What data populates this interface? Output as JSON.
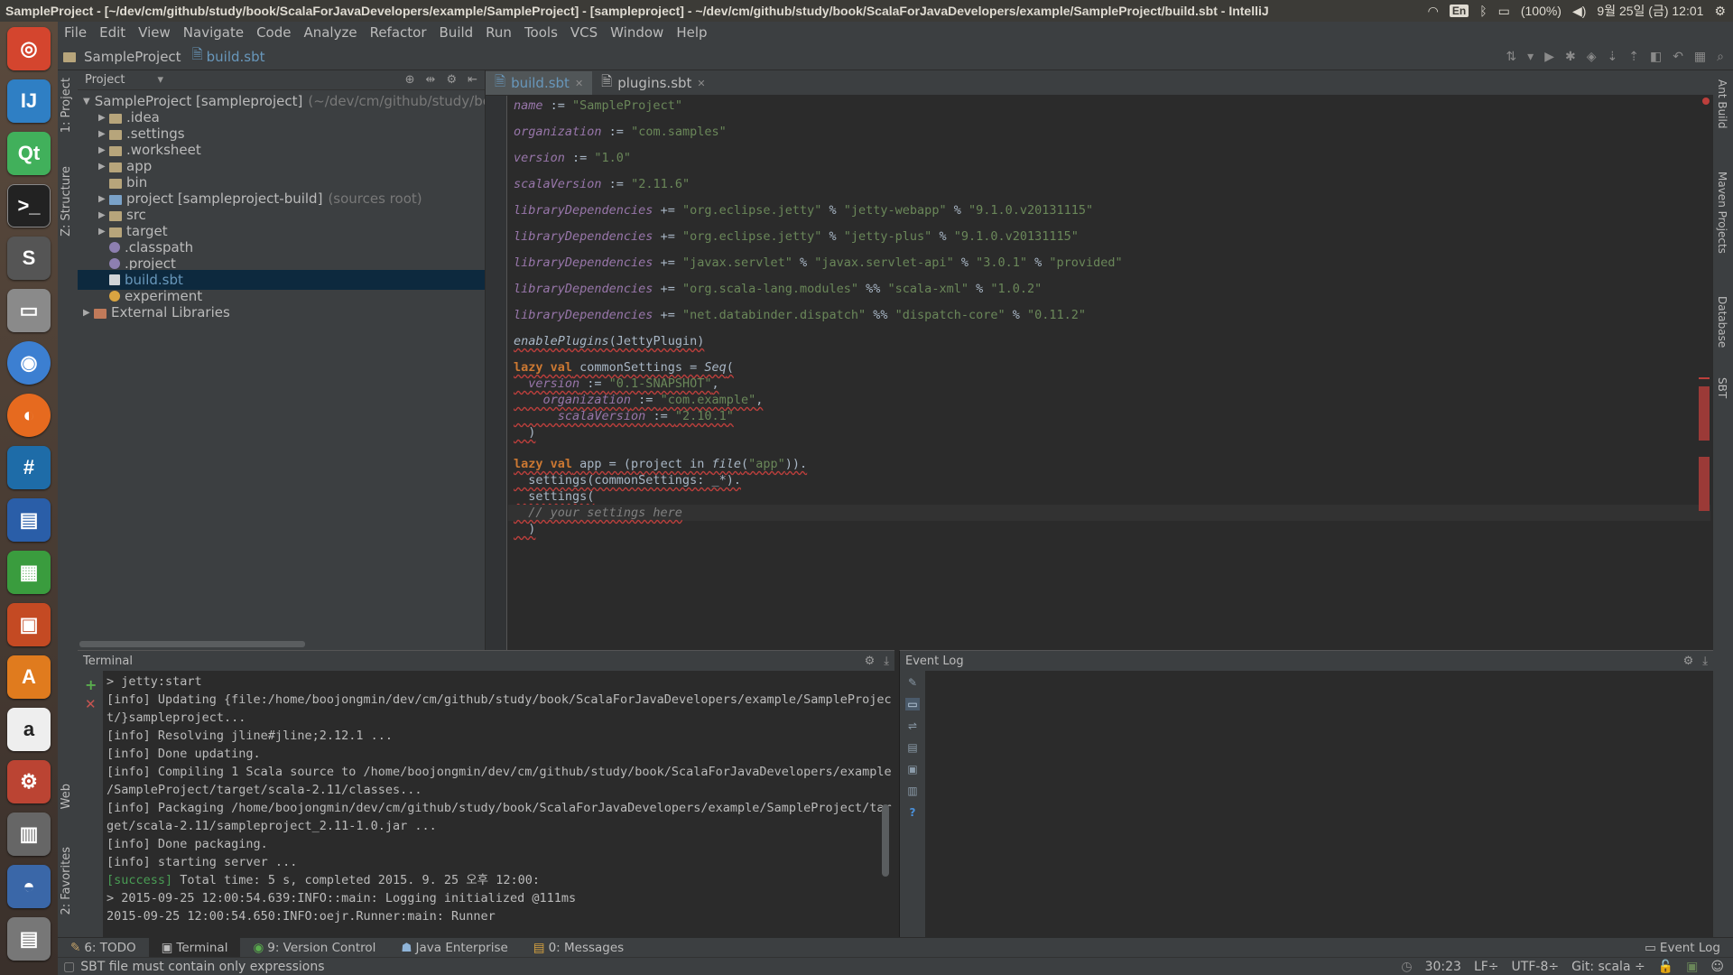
{
  "system": {
    "title": "SampleProject - [~/dev/cm/github/study/book/ScalaForJavaDevelopers/example/SampleProject] - [sampleproject] - ~/dev/cm/github/study/book/ScalaForJavaDevelopers/example/SampleProject/build.sbt - IntelliJ",
    "keyboard": "En",
    "battery": "(100%)",
    "datetime": "9월 25일 (금) 12:01"
  },
  "menu": [
    "File",
    "Edit",
    "View",
    "Navigate",
    "Code",
    "Analyze",
    "Refactor",
    "Build",
    "Run",
    "Tools",
    "VCS",
    "Window",
    "Help"
  ],
  "breadcrumbs": {
    "project": "SampleProject",
    "file": "build.sbt"
  },
  "left_tabs": {
    "project": "1: Project",
    "structure": "Z: Structure",
    "web": "Web",
    "favorites": "2: Favorites"
  },
  "right_tabs": {
    "ant": "Ant Build",
    "maven": "Maven Projects",
    "database": "Database",
    "sbt": "SBT"
  },
  "project_panel": {
    "view": "Project",
    "tree": [
      {
        "label": "SampleProject [sampleproject]",
        "note": "(~/dev/cm/github/study/boo",
        "arrow": "▼",
        "kind": "folder"
      },
      {
        "label": ".idea",
        "arrow": "▶",
        "kind": "folder"
      },
      {
        "label": ".settings",
        "arrow": "▶",
        "kind": "folder"
      },
      {
        "label": ".worksheet",
        "arrow": "▶",
        "kind": "folder"
      },
      {
        "label": "app",
        "arrow": "▶",
        "kind": "folder"
      },
      {
        "label": "bin",
        "arrow": "",
        "kind": "folder"
      },
      {
        "label": "project [sampleproject-build]",
        "note": "(sources root)",
        "arrow": "▶",
        "kind": "module"
      },
      {
        "label": "src",
        "arrow": "▶",
        "kind": "folder"
      },
      {
        "label": "target",
        "arrow": "▶",
        "kind": "folder"
      },
      {
        "label": ".classpath",
        "arrow": "",
        "kind": "file"
      },
      {
        "label": ".project",
        "arrow": "",
        "kind": "file"
      },
      {
        "label": "build.sbt",
        "arrow": "",
        "kind": "sbt",
        "selected": true
      },
      {
        "label": "experiment",
        "arrow": "",
        "kind": "run"
      },
      {
        "label": "External Libraries",
        "arrow": "▶",
        "kind": "lib"
      }
    ]
  },
  "editor_tabs": [
    {
      "label": "build.sbt",
      "active": true
    },
    {
      "label": "plugins.sbt",
      "active": false
    }
  ],
  "code": {
    "l1": {
      "a": "name",
      "b": " := ",
      "c": "\"SampleProject\""
    },
    "l2": {
      "a": "organization",
      "b": " := ",
      "c": "\"com.samples\""
    },
    "l3": {
      "a": "version",
      "b": " := ",
      "c": "\"1.0\""
    },
    "l4": {
      "a": "scalaVersion",
      "b": " := ",
      "c": "\"2.11.6\""
    },
    "l5": {
      "a": "libraryDependencies",
      "b": " += ",
      "c": "\"org.eclipse.jetty\"",
      "d": " % ",
      "e": "\"jetty-webapp\"",
      "f": " % ",
      "g": "\"9.1.0.v20131115\""
    },
    "l6": {
      "a": "libraryDependencies",
      "b": " += ",
      "c": "\"org.eclipse.jetty\"",
      "d": " % ",
      "e": "\"jetty-plus\"",
      "f": " % ",
      "g": "\"9.1.0.v20131115\""
    },
    "l7": {
      "a": "libraryDependencies",
      "b": " += ",
      "c": "\"javax.servlet\"",
      "d": " % ",
      "e": "\"javax.servlet-api\"",
      "f": " % ",
      "g": "\"3.0.1\"",
      "h": " % ",
      "i": "\"provided\""
    },
    "l8": {
      "a": "libraryDependencies",
      "b": " += ",
      "c": "\"org.scala-lang.modules\"",
      "d": " %% ",
      "e": "\"scala-xml\"",
      "f": " % ",
      "g": "\"1.0.2\""
    },
    "l9": {
      "a": "libraryDependencies",
      "b": " += ",
      "c": "\"net.databinder.dispatch\"",
      "d": " %% ",
      "e": "\"dispatch-core\"",
      "f": " % ",
      "g": "\"0.11.2\""
    },
    "l10": {
      "a": "enablePlugins",
      "b": "(JettyPlugin)"
    },
    "l11": {
      "a": "lazy val",
      "b": " commonSettings = ",
      "c": "Seq",
      "d": "("
    },
    "l12": {
      "a": "  version",
      "b": " := ",
      "c": "\"0.1-SNAPSHOT\"",
      "d": ","
    },
    "l13": {
      "a": "    organization",
      "b": " := ",
      "c": "\"com.example\"",
      "d": ","
    },
    "l14": {
      "a": "      scalaVersion",
      "b": " := ",
      "c": "\"2.10.1\""
    },
    "l15": {
      "a": "  )"
    },
    "l16": {
      "a": "lazy val",
      "b": " app = (project in ",
      "c": "file",
      "d": "(",
      "e": "\"app\"",
      "f": ")).",
      "g": ""
    },
    "l17": {
      "a": "  settings(commonSettings: _*)."
    },
    "l18": {
      "a": "  settings("
    },
    "l19": {
      "a": "  // your settings here"
    },
    "l20": {
      "a": "  )"
    }
  },
  "terminal": {
    "title": "Terminal",
    "lines": [
      "> jetty:start",
      "[info] Updating {file:/home/boojongmin/dev/cm/github/study/book/ScalaForJavaDevelopers/example/SampleProjec",
      "t/}sampleproject...",
      "[info] Resolving jline#jline;2.12.1 ...",
      "[info] Done updating.",
      "[info] Compiling 1 Scala source to /home/boojongmin/dev/cm/github/study/book/ScalaForJavaDevelopers/example",
      "/SampleProject/target/scala-2.11/classes...",
      "[info] Packaging /home/boojongmin/dev/cm/github/study/book/ScalaForJavaDevelopers/example/SampleProject/tar",
      "get/scala-2.11/sampleproject_2.11-1.0.jar ...",
      "[info] Done packaging.",
      "[info] starting server ..."
    ],
    "success_tag": "[success]",
    "success_rest": " Total time: 5 s, completed 2015. 9. 25 오후 12:00:",
    "tail": [
      "> 2015-09-25 12:00:54.639:INFO::main: Logging initialized @111ms",
      "2015-09-25 12:00:54.650:INFO:oejr.Runner:main: Runner"
    ]
  },
  "event_log": {
    "title": "Event Log"
  },
  "bottom_tabs": {
    "todo": "6: TODO",
    "terminal": "Terminal",
    "vc": "9: Version Control",
    "je": "Java Enterprise",
    "messages": "0: Messages",
    "eventlog": "Event Log"
  },
  "status": {
    "message": "SBT file must contain only expressions",
    "position": "30:23",
    "line_sep": "LF÷",
    "encoding": "UTF-8÷",
    "git": "Git: scala ÷"
  },
  "colors": {
    "accent": "#6897bb",
    "string": "#6a8759",
    "keyword": "#cc7832",
    "field": "#9876aa",
    "error": "#bc3f3c",
    "selection": "#0d293e"
  }
}
